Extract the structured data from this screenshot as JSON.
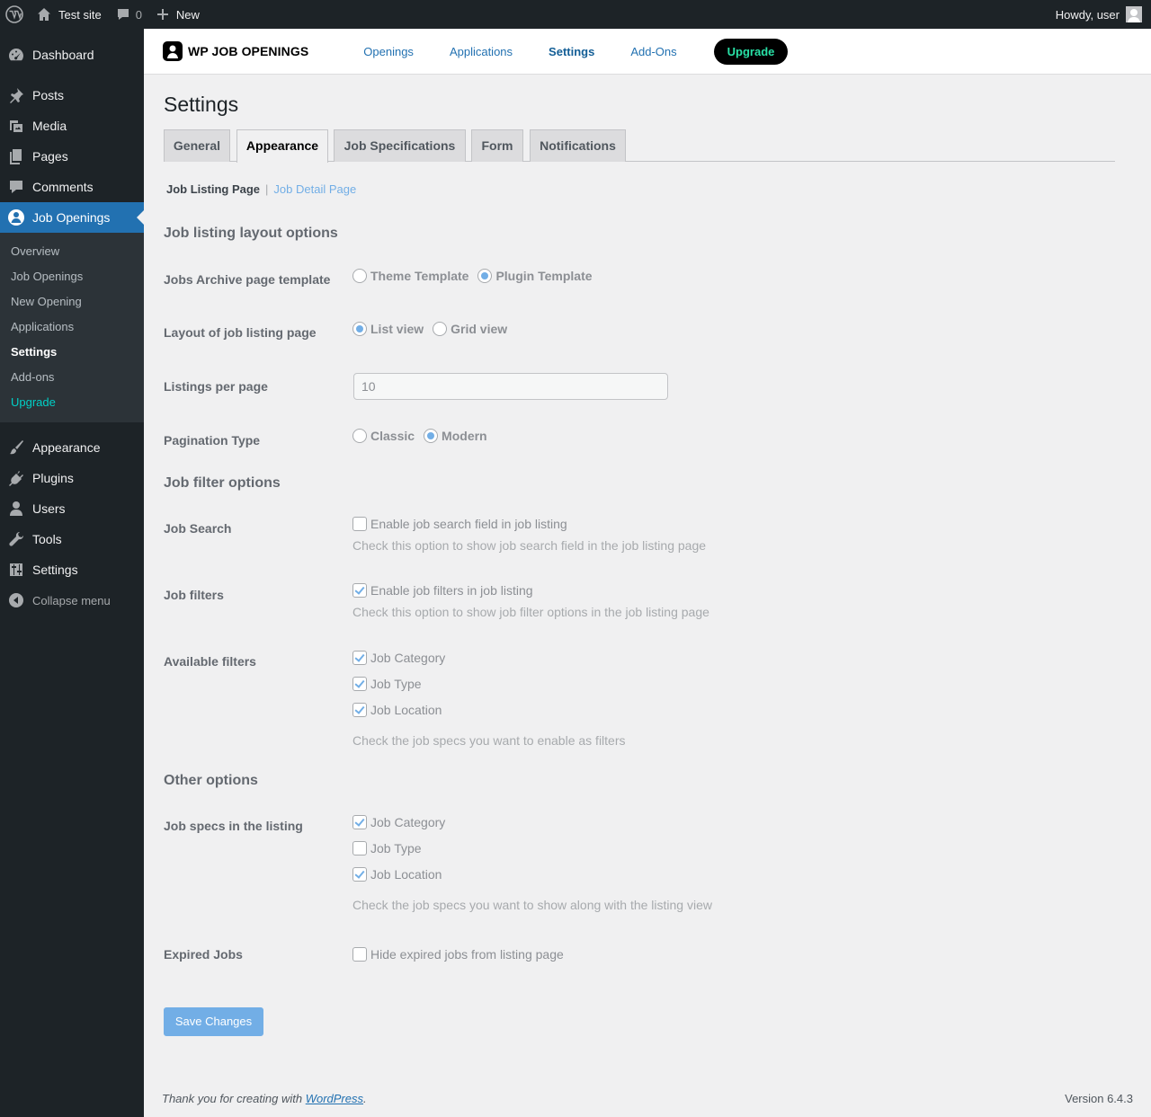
{
  "adminbar": {
    "site_name": "Test site",
    "comments_count": "0",
    "new_label": "New",
    "greeting": "Howdy, user"
  },
  "sidebar": {
    "top_items": [
      {
        "label": "Dashboard",
        "icon": "dashboard-icon"
      },
      {
        "label": "Posts",
        "icon": "pin-icon"
      },
      {
        "label": "Media",
        "icon": "media-icon"
      },
      {
        "label": "Pages",
        "icon": "pages-icon"
      },
      {
        "label": "Comments",
        "icon": "comment-icon"
      },
      {
        "label": "Job Openings",
        "icon": "job-openings-icon"
      }
    ],
    "submenu": [
      "Overview",
      "Job Openings",
      "New Opening",
      "Applications",
      "Settings",
      "Add-ons",
      "Upgrade"
    ],
    "bottom_items": [
      {
        "label": "Appearance",
        "icon": "brush-icon"
      },
      {
        "label": "Plugins",
        "icon": "plugin-icon"
      },
      {
        "label": "Users",
        "icon": "user-icon"
      },
      {
        "label": "Tools",
        "icon": "wrench-icon"
      },
      {
        "label": "Settings",
        "icon": "settings-icon"
      }
    ],
    "collapse_label": "Collapse menu"
  },
  "plugin_header": {
    "logo_text": "WP JOB OPENINGS",
    "nav": [
      "Openings",
      "Applications",
      "Settings",
      "Add-Ons"
    ],
    "upgrade_label": "Upgrade"
  },
  "page": {
    "title": "Settings",
    "tabs": [
      "General",
      "Appearance",
      "Job Specifications",
      "Form",
      "Notifications"
    ],
    "active_tab": "Appearance",
    "subnav": {
      "current": "Job Listing Page",
      "separator": "|",
      "link": "Job Detail Page"
    }
  },
  "layout_section": {
    "title": "Job listing layout options",
    "archive_template": {
      "label": "Jobs Archive page template",
      "options": [
        "Theme Template",
        "Plugin Template"
      ],
      "selected": "Plugin Template"
    },
    "layout": {
      "label": "Layout of job listing page",
      "options": [
        "List view",
        "Grid view"
      ],
      "selected": "List view"
    },
    "listings_per_page": {
      "label": "Listings per page",
      "value": "10"
    },
    "pagination": {
      "label": "Pagination Type",
      "options": [
        "Classic",
        "Modern"
      ],
      "selected": "Modern"
    }
  },
  "filter_section": {
    "title": "Job filter options",
    "job_search": {
      "label": "Job Search",
      "checkbox_label": "Enable job search field in job listing",
      "checked": false,
      "description": "Check this option to show job search field in the job listing page"
    },
    "job_filters": {
      "label": "Job filters",
      "checkbox_label": "Enable job filters in job listing",
      "checked": true,
      "description": "Check this option to show job filter options in the job listing page"
    },
    "available_filters": {
      "label": "Available filters",
      "items": [
        {
          "label": "Job Category",
          "checked": true
        },
        {
          "label": "Job Type",
          "checked": true
        },
        {
          "label": "Job Location",
          "checked": true
        }
      ],
      "description": "Check the job specs you want to enable as filters"
    }
  },
  "other_section": {
    "title": "Other options",
    "specs_in_listing": {
      "label": "Job specs in the listing",
      "items": [
        {
          "label": "Job Category",
          "checked": true
        },
        {
          "label": "Job Type",
          "checked": false
        },
        {
          "label": "Job Location",
          "checked": true
        }
      ],
      "description": "Check the job specs you want to show along with the listing view"
    },
    "expired_jobs": {
      "label": "Expired Jobs",
      "checkbox_label": "Hide expired jobs from listing page",
      "checked": false
    }
  },
  "save_label": "Save Changes",
  "footer": {
    "thanks_prefix": "Thank you for creating with ",
    "link": "WordPress",
    "suffix": ".",
    "version": "Version 6.4.3"
  },
  "colors": {
    "admin_bar": "#1d2327",
    "primary": "#2271b1",
    "accent": "#72aee6",
    "upgrade_text": "#29e0a6"
  }
}
